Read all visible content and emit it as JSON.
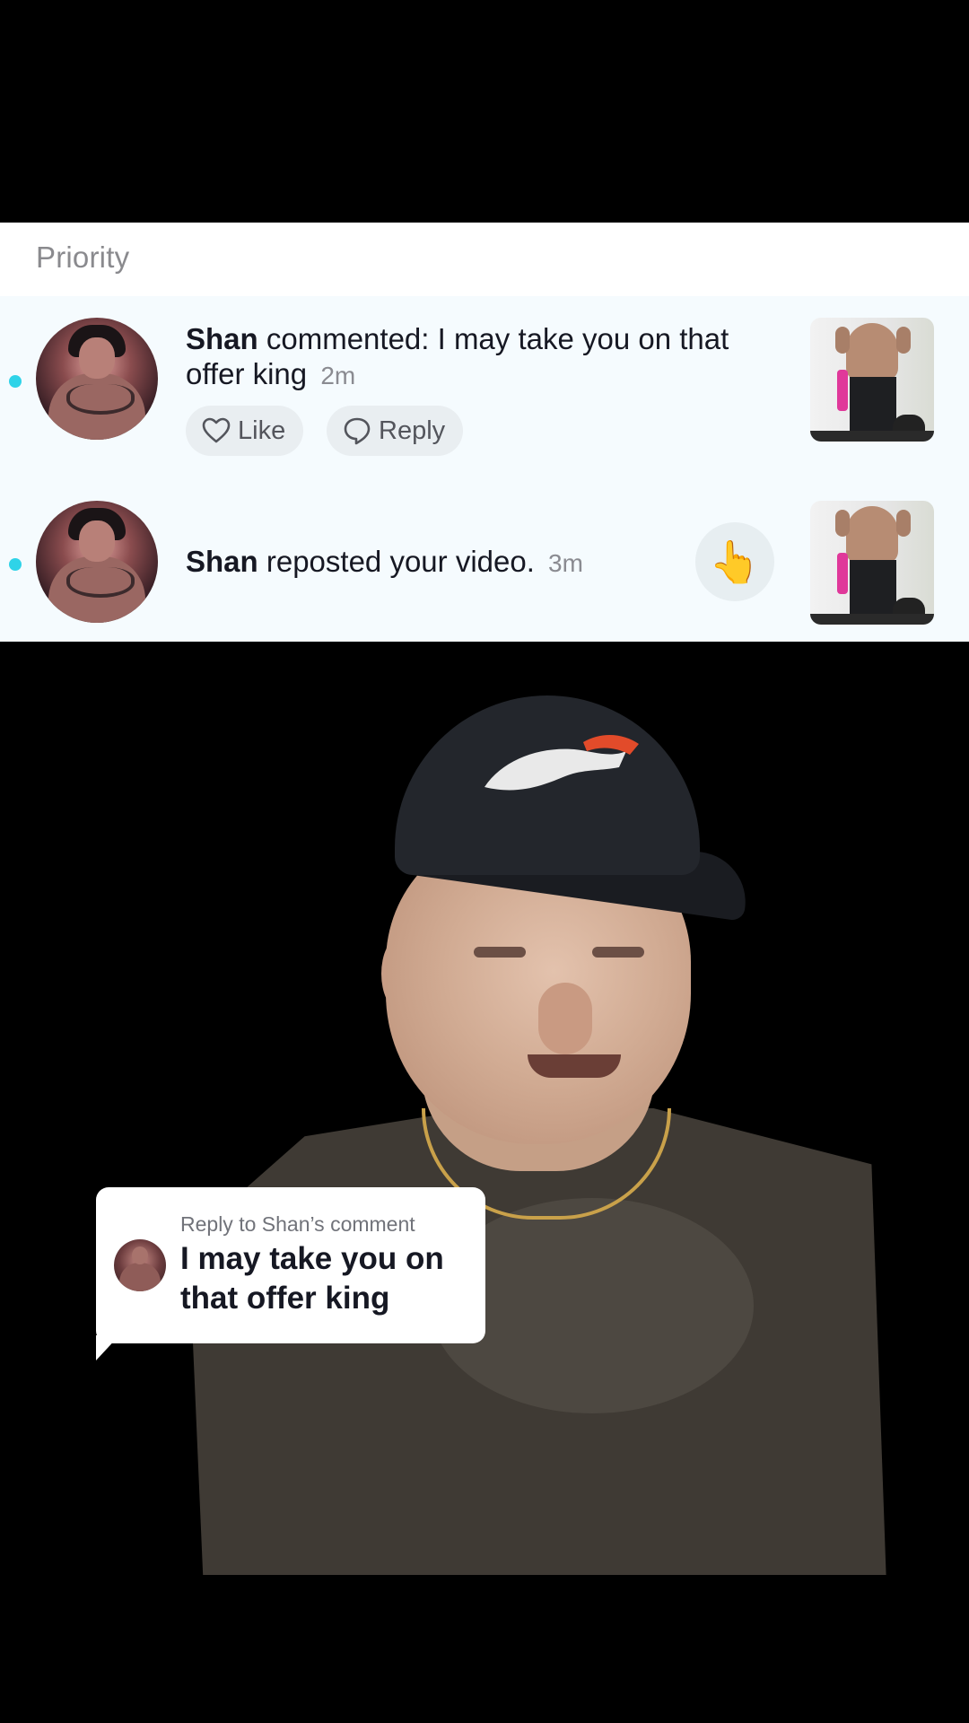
{
  "section": {
    "title": "Priority"
  },
  "notifications": [
    {
      "user": "Shan",
      "action": "commented: I may take you on that offer king",
      "time": "2m",
      "actions": {
        "like_label": "Like",
        "reply_label": "Reply"
      },
      "thumbnail": "video-thumbnail",
      "unread": true
    },
    {
      "user": "Shan",
      "action": "reposted your video.",
      "time": "3m",
      "emoji": "👆",
      "thumbnail": "video-thumbnail",
      "unread": true
    }
  ],
  "reply_overlay": {
    "title": "Reply to Shan’s comment",
    "comment": "I may take you on that offer king"
  },
  "colors": {
    "unread_dot": "#2fd3e8",
    "panel_background": "#f5fbfe",
    "pill_background": "#e9eef1",
    "text_primary": "#161823",
    "text_secondary": "#8a8b91"
  }
}
